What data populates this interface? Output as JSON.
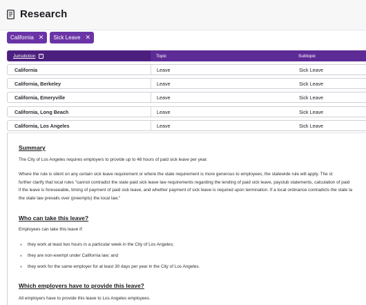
{
  "header": {
    "title": "Research",
    "icon": "document-icon"
  },
  "filters": [
    {
      "label": "California"
    },
    {
      "label": "Sick Leave"
    }
  ],
  "table": {
    "columns": {
      "jurisdiction": "Jurisdiction",
      "help": "?",
      "topic": "Topic",
      "subtopic": "Subtopic"
    },
    "rows": [
      {
        "jurisdiction": "California",
        "topic": "Leave",
        "subtopic": "Sick Leave"
      },
      {
        "jurisdiction": "California, Berkeley",
        "topic": "Leave",
        "subtopic": "Sick Leave"
      },
      {
        "jurisdiction": "California, Emeryville",
        "topic": "Leave",
        "subtopic": "Sick Leave"
      },
      {
        "jurisdiction": "California, Long Beach",
        "topic": "Leave",
        "subtopic": "Sick Leave"
      },
      {
        "jurisdiction": "California, Los Angeles",
        "topic": "Leave",
        "subtopic": "Sick Leave"
      }
    ]
  },
  "detail": {
    "summary_heading": "Summary",
    "summary_p1": "The City of Los Angeles requires employers to provide up to 48 hours of paid sick leave per year.",
    "summary_p2_l1": "Where the rule is silent on any certain sick leave requirement or where the state requirement is more generous to employees, the statewide rule will apply. The st",
    "summary_p2_l2": "further clarify that local rules \"cannot contradict the state paid sick leave law requirements regarding the lending of paid sick leave, paystub statements, calculation of paid",
    "summary_p2_l3": "if the leave is foreseeable, timing of payment of paid sick leave, and whether payment of sick leave is required upon termination. If a local ordinance contradicts the state la",
    "summary_p2_l4": "the state law prevails over (preempts) the local law.\"",
    "who_heading": "Who can take this leave?",
    "who_intro": "Employees can take this leave if:",
    "who_bullets": [
      "they work at least two hours in a particular week in the City of Los Angeles;",
      "they are non-exempt under California law; and",
      "they work for the same employer for at least 30 days per year in the City of Los Angeles."
    ],
    "which_heading": "Which employers have to provide this leave?",
    "which_p1": "All employers have to provide this leave to Los Angeles employees."
  }
}
